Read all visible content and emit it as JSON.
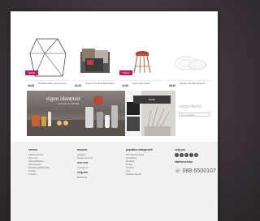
{
  "products": [
    {
      "price": "49,95",
      "desc": "Windlicht Glas Geometrisch",
      "sale": "SALE",
      "sale_color": "#c41a5b"
    },
    {
      "price": "34,95",
      "desc": "Kussen Fotoprint Meubelstof",
      "sale": ""
    },
    {
      "price": "12,95",
      "desc": "Kruk Koper Rood",
      "sale": "SALE",
      "sale_color": "#c41a5b"
    },
    {
      "price": "89,95",
      "desc": "Servies Set Wit Porselein",
      "sale": ""
    }
  ],
  "banner": {
    "title": "eigen identiteit",
    "subtitle": "LIVING & MORE"
  },
  "side_banner": {
    "label": "MOOI"
  },
  "newsletter": {
    "title": "nieuwsbrief",
    "placeholder": "Uw e-mailadres"
  },
  "footer": {
    "col1": {
      "heading": "service",
      "links": [
        "Klantenservice",
        "Over ons",
        "Verzendkosten",
        "Retourneren",
        "Betaalmogelijkheden",
        "Privacy",
        "Contact"
      ]
    },
    "col2": {
      "heading": "account",
      "links": [
        "Inloggen",
        "Nieuw account"
      ],
      "heading2": "over ons",
      "links2": [
        "Showroom"
      ],
      "heading3": "volg ons",
      "links3": [
        "Facebook"
      ]
    },
    "col3": {
      "heading": "populaire categorieën",
      "links": [
        "Woonaccessoires",
        "Verlichting",
        "Meubels",
        "Textiel",
        "Keuken",
        "Tuin",
        "Cadeau ideeën"
      ]
    },
    "col4": {
      "heading": "volg ons",
      "social": [
        "f",
        "t",
        "p",
        "i",
        "g"
      ],
      "heading2": "klantenservice",
      "phone": "088-5500107"
    }
  }
}
